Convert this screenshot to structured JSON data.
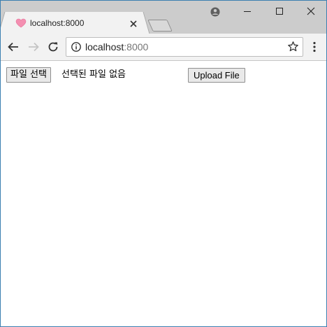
{
  "tab": {
    "title": "localhost:8000",
    "favicon": "heart-icon"
  },
  "window_controls": {
    "profile": "profile-icon",
    "minimize": "minimize-icon",
    "maximize": "maximize-icon",
    "close": "close-icon"
  },
  "toolbar": {
    "back": "back-arrow-icon",
    "forward": "forward-arrow-icon",
    "reload": "reload-icon",
    "menu": "more-vert-icon"
  },
  "omnibox": {
    "url_host": "localhost",
    "url_port": ":8000",
    "info": "info-icon",
    "bookmark": "star-icon"
  },
  "page": {
    "file_button_label": "파일 선택",
    "file_status": "선택된 파일 없음",
    "upload_button_label": "Upload File"
  },
  "colors": {
    "window_border": "#3c7fb1",
    "titlebar": "#cccccc",
    "tab_bg": "#f2f2f2",
    "favicon": "#f48fb1"
  }
}
